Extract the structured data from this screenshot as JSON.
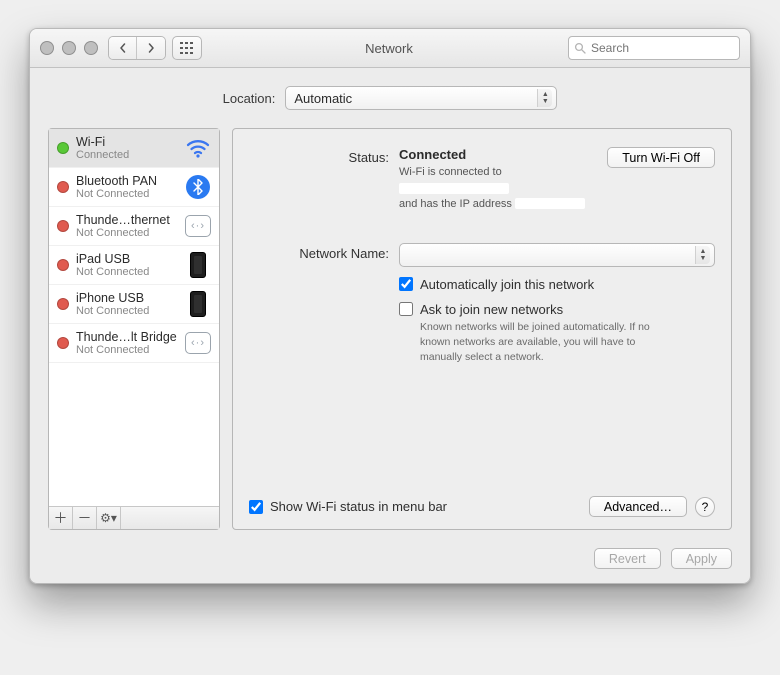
{
  "window": {
    "title": "Network"
  },
  "search": {
    "placeholder": "Search"
  },
  "location": {
    "label": "Location:",
    "value": "Automatic"
  },
  "sidebar": {
    "services": [
      {
        "name": "Wi-Fi",
        "status": "Connected",
        "dot": "green",
        "icon": "wifi",
        "selected": true
      },
      {
        "name": "Bluetooth PAN",
        "status": "Not Connected",
        "dot": "red",
        "icon": "bt",
        "selected": false
      },
      {
        "name": "Thunde…thernet",
        "status": "Not Connected",
        "dot": "red",
        "icon": "tbolt",
        "selected": false
      },
      {
        "name": "iPad USB",
        "status": "Not Connected",
        "dot": "red",
        "icon": "phone",
        "selected": false
      },
      {
        "name": "iPhone USB",
        "status": "Not Connected",
        "dot": "red",
        "icon": "phone",
        "selected": false
      },
      {
        "name": "Thunde…lt Bridge",
        "status": "Not Connected",
        "dot": "red",
        "icon": "tbolt",
        "selected": false
      }
    ]
  },
  "details": {
    "status_label": "Status:",
    "status_value": "Connected",
    "wifi_toggle": "Turn Wi-Fi Off",
    "status_line1": "Wi-Fi is connected to",
    "status_line2": "and has the IP address",
    "network_name_label": "Network Name:",
    "network_name_value": "",
    "auto_join": "Automatically join this network",
    "auto_join_checked": true,
    "ask_join": "Ask to join new networks",
    "ask_join_checked": false,
    "ask_join_explain": "Known networks will be joined automatically. If no known networks are available, you will have to manually select a network.",
    "show_menubar": "Show Wi-Fi status in menu bar",
    "show_menubar_checked": true,
    "advanced_btn": "Advanced…"
  },
  "footer": {
    "revert": "Revert",
    "apply": "Apply"
  }
}
